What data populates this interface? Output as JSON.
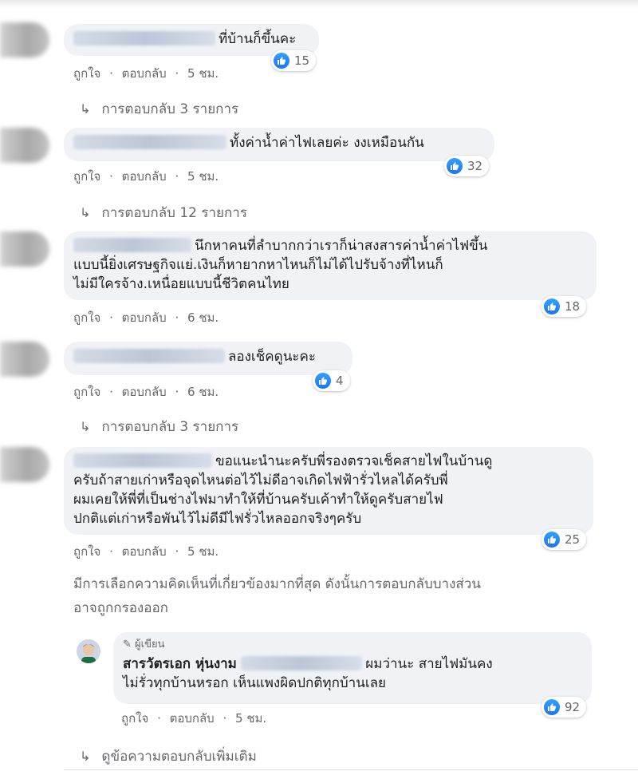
{
  "comments": [
    {
      "text": "ที่บ้านก็ขึ้นคะ",
      "like": "ถูกใจ",
      "reply": "ตอบกลับ",
      "time": "5 ชม.",
      "reactions": "15",
      "replies_link": "การตอบกลับ 3 รายการ"
    },
    {
      "text": "ทั้งค่าน้ำค่าไฟเลยค่ะ งงเหมือนกัน",
      "like": "ถูกใจ",
      "reply": "ตอบกลับ",
      "time": "5 ชม.",
      "reactions": "32",
      "replies_link": "การตอบกลับ 12 รายการ"
    },
    {
      "line1": "นึกหาคนที่ลำบากกว่าเราก็น่าสงสารค่าน้ำค่าไฟขึ้น",
      "line2": "แบบนี้ยิ่งเศรษฐกิจแย่.เงินก็หายากหาไหนก็ไม่ได้ไปรับจ้างที่ไหนก็",
      "line3": "ไม่มีใครจ้าง.เหนื่อยแบบนี้ชีวิตคนไทย",
      "like": "ถูกใจ",
      "reply": "ตอบกลับ",
      "time": "6 ชม.",
      "reactions": "18"
    },
    {
      "text": "ลองเช็คดูนะคะ",
      "like": "ถูกใจ",
      "reply": "ตอบกลับ",
      "time": "6 ชม.",
      "reactions": "4",
      "replies_link": "การตอบกลับ 3 รายการ"
    },
    {
      "line1": "ขอแนะนำนะครับพี่รองตรวจเช็คสายไฟในบ้านดู",
      "line2": "ครับถ้าสายเก่าหรือจุดไหนต่อไว้ไม่ดีอาจเกิดไฟฟ้ารั่วไหลได้ครับพี่",
      "line3": "ผมเคยให้พี่ที่เป็นช่างไฟมาทำให้ที่บ้านครับเค้าทำให้ดูครับสายไฟ",
      "line4": "ปกติแต่เก่าหรือพันไว้ไม่ดีมีไฟรั่วไหลออกจริงๆครับ",
      "like": "ถูกใจ",
      "reply": "ตอบกลับ",
      "time": "5 ชม.",
      "reactions": "25"
    }
  ],
  "notice": {
    "line1": "มีการเลือกความคิดเห็นที่เกี่ยวข้องมากที่สุด ดังนั้นการตอบกลับบางส่วน",
    "line2": "อาจถูกกรองออก"
  },
  "author_reply": {
    "badge": "ผู้เขียน",
    "name": "สารวัตรเอก หุ่นงาม",
    "text_after": "ผมว่านะ สายไฟมันคง",
    "line2": "ไม่รั่วทุกบ้านหรอก เห็นแพงผิดปกติทุกบ้านเลย",
    "like": "ถูกใจ",
    "reply": "ตอบกลับ",
    "time": "5 ชม.",
    "reactions": "92"
  },
  "more_replies": "ดูข้อความตอบกลับเพิ่มเติม",
  "sep": "·",
  "colors": {
    "like_blue": "#1877f2",
    "bubble_bg": "#f0f2f5",
    "meta_gray": "#65676b"
  }
}
